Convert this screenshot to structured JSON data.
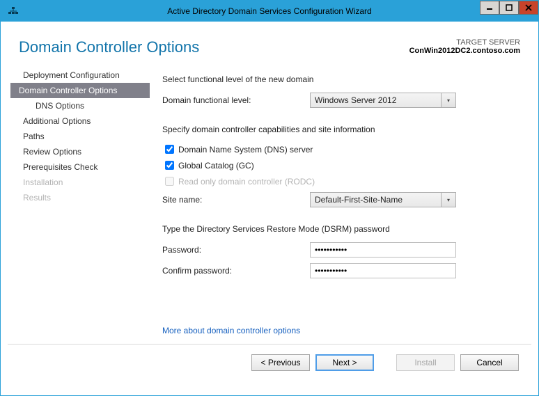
{
  "window": {
    "title": "Active Directory Domain Services Configuration Wizard"
  },
  "header": {
    "page_title": "Domain Controller Options",
    "target_label": "TARGET SERVER",
    "target_server": "ConWin2012DC2.contoso.com"
  },
  "sidebar": {
    "items": [
      {
        "label": "Deployment Configuration"
      },
      {
        "label": "Domain Controller Options"
      },
      {
        "label": "DNS Options"
      },
      {
        "label": "Additional Options"
      },
      {
        "label": "Paths"
      },
      {
        "label": "Review Options"
      },
      {
        "label": "Prerequisites Check"
      },
      {
        "label": "Installation"
      },
      {
        "label": "Results"
      }
    ]
  },
  "form": {
    "functional_section": "Select functional level of the new domain",
    "domain_functional_label": "Domain functional level:",
    "domain_functional_value": "Windows Server 2012",
    "capabilities_section": "Specify domain controller capabilities and site information",
    "dns_label": "Domain Name System (DNS) server",
    "gc_label": "Global Catalog (GC)",
    "rodc_label": "Read only domain controller (RODC)",
    "site_label": "Site name:",
    "site_value": "Default-First-Site-Name",
    "dsrm_section": "Type the Directory Services Restore Mode (DSRM) password",
    "password_label": "Password:",
    "password_value": "•••••••••••",
    "confirm_label": "Confirm password:",
    "confirm_value": "•••••••••••",
    "more_link": "More about domain controller options"
  },
  "footer": {
    "previous": "< Previous",
    "next": "Next >",
    "install": "Install",
    "cancel": "Cancel"
  }
}
